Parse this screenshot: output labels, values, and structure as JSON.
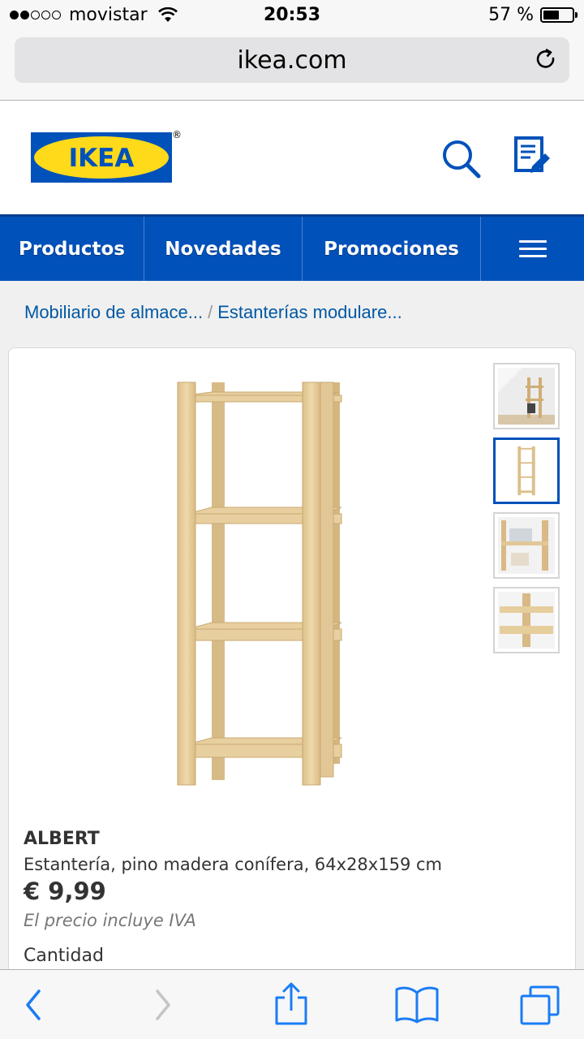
{
  "status_bar": {
    "carrier": "movistar",
    "time": "20:53",
    "battery_percent": "57 %",
    "battery_level": 0.57,
    "signal_bars": 2
  },
  "browser": {
    "url": "ikea.com"
  },
  "header": {
    "logo_text": "IKEA",
    "registered_mark": "®"
  },
  "nav": {
    "items": [
      "Productos",
      "Novedades",
      "Promociones"
    ]
  },
  "breadcrumb": {
    "items": [
      "Mobiliario de almace...",
      "Estanterías modulare..."
    ],
    "separator": "/"
  },
  "product": {
    "name": "ALBERT",
    "description": "Estantería, pino madera conífera, 64x28x159 cm",
    "price": "€ 9,99",
    "price_note": "El precio incluye IVA",
    "quantity_label": "Cantidad",
    "thumbnails_count": 4,
    "active_thumbnail": 2
  },
  "colors": {
    "ikea_blue": "#0051ba",
    "ikea_yellow": "#ffda1a",
    "link_blue": "#0058a3",
    "ios_blue": "#1a7cf5",
    "wood": "#e8cfa0"
  }
}
